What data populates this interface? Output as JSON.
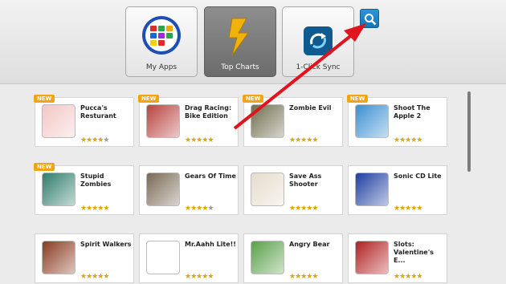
{
  "tabs": [
    {
      "label": "My Apps",
      "icon": "grid-apps-icon",
      "active": false
    },
    {
      "label": "Top Charts",
      "icon": "top-charts-icon",
      "active": true
    },
    {
      "label": "1-Click Sync",
      "icon": "sync-icon",
      "active": false
    }
  ],
  "search": {
    "icon": "search-icon"
  },
  "new_badge": "NEW",
  "apps": [
    {
      "name": "Pucca's\nResturant",
      "new": true,
      "rating": 4,
      "thumb_color": "#f4c6c6",
      "icon": "pucca-icon"
    },
    {
      "name": "Drag Racing:\nBike Edition",
      "new": true,
      "rating": 5,
      "thumb_color": "#b9433f",
      "icon": "bike-icon"
    },
    {
      "name": "Zombie Evil",
      "new": true,
      "rating": 5,
      "thumb_color": "#6f6e4f",
      "icon": "soldier-icon"
    },
    {
      "name": "Shoot The\nApple 2",
      "new": true,
      "rating": 5,
      "thumb_color": "#3a8fd1",
      "icon": "apple-target-icon"
    },
    {
      "name": "Stupid Zombies",
      "new": true,
      "rating": 5,
      "thumb_color": "#2f7d6b",
      "icon": "zombie-icon"
    },
    {
      "name": "Gears Of Time",
      "new": false,
      "rating": 4,
      "thumb_color": "#7a6a55",
      "icon": "gears-icon"
    },
    {
      "name": "Save Ass\nShooter",
      "new": false,
      "rating": 5,
      "thumb_color": "#e6dccb",
      "icon": "shooter-icon"
    },
    {
      "name": "Sonic CD Lite",
      "new": false,
      "rating": 5,
      "thumb_color": "#1f3fa1",
      "icon": "sonic-icon"
    },
    {
      "name": "Spirit Walkers",
      "new": false,
      "rating": 5,
      "thumb_color": "#8a3a21",
      "icon": "tree-icon"
    },
    {
      "name": "Mr.Aahh Lite!!",
      "new": false,
      "rating": 5,
      "thumb_color": "#ffffff",
      "icon": "mr-aahh-icon"
    },
    {
      "name": "Angry Bear",
      "new": false,
      "rating": 5,
      "thumb_color": "#5aa04a",
      "icon": "bear-icon"
    },
    {
      "name": "Slots:\nValentine's E...",
      "new": false,
      "rating": 5,
      "thumb_color": "#b12020",
      "icon": "slots-icon"
    }
  ],
  "colors": {
    "accent": "#1774b6",
    "arrow": "#e0141c",
    "new_badge": "#f2a412",
    "star": "#e0a400"
  }
}
